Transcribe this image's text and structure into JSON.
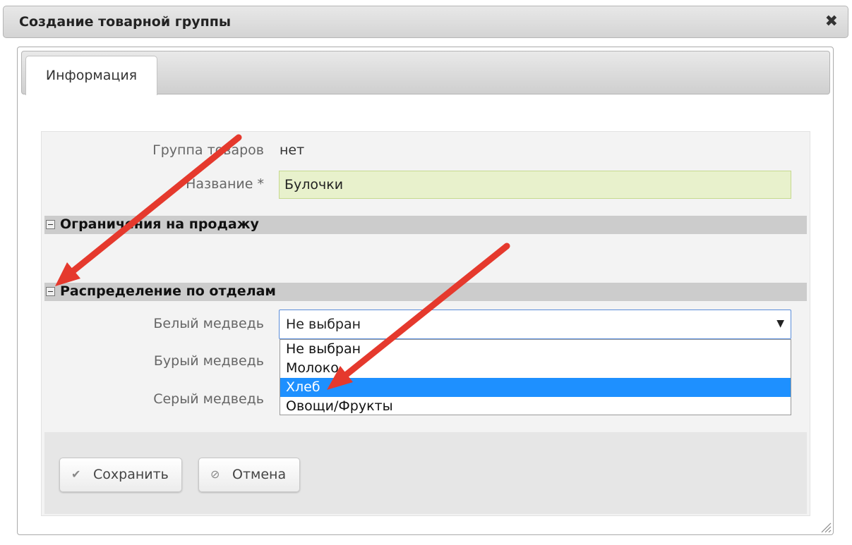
{
  "dialog": {
    "title": "Создание товарной группы",
    "close_symbol": "✖"
  },
  "tabs": [
    {
      "label": "Информация"
    }
  ],
  "form": {
    "group": {
      "label": "Группа товаров",
      "value": "нет"
    },
    "name": {
      "label": "Название *",
      "value": "Булочки"
    }
  },
  "sections": {
    "restrictions": {
      "title": "Ограничения на продажу"
    },
    "distribution": {
      "title": "Распределение по отделам"
    }
  },
  "departments": [
    {
      "label": "Белый медведь"
    },
    {
      "label": "Бурый медведь"
    },
    {
      "label": "Серый медведь"
    }
  ],
  "select": {
    "value": "Не выбран",
    "arrow": "▼",
    "options": [
      "Не выбран",
      "Молоко",
      "Хлеб",
      "Овощи/Фрукты"
    ],
    "highlighted_option": "Хлеб"
  },
  "buttons": {
    "save": {
      "label": "Сохранить",
      "icon": "✔"
    },
    "cancel": {
      "label": "Отмена",
      "icon": "⊘"
    }
  },
  "colors": {
    "annotation_arrow": "#e5392d",
    "highlight": "#1e90ff",
    "required_field": "#e8f1cc"
  }
}
